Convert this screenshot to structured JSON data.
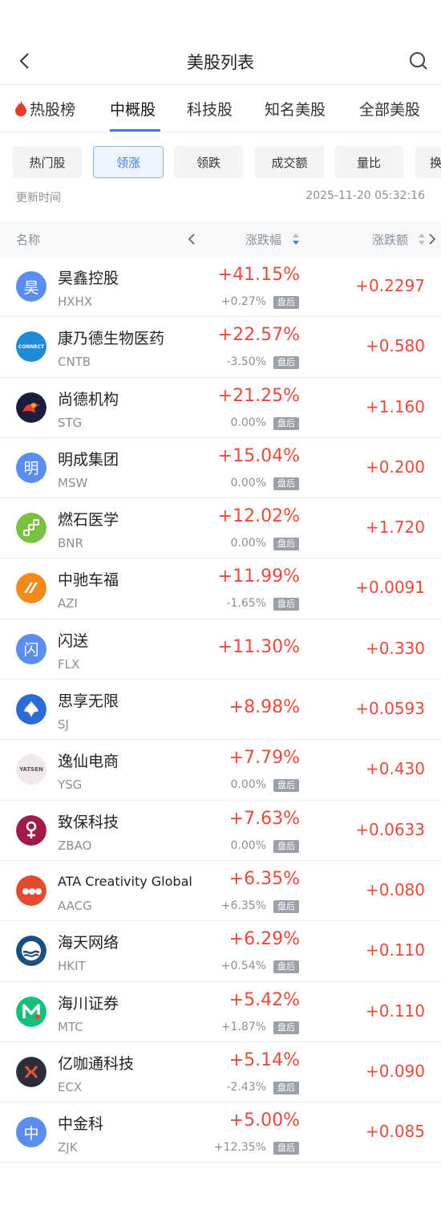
{
  "nav": {
    "title": "美股列表"
  },
  "tabs": [
    "热股榜",
    "中概股",
    "科技股",
    "知名美股",
    "全部美股"
  ],
  "chips": [
    "热门股",
    "领涨",
    "领跌",
    "成交额",
    "量比",
    "换"
  ],
  "update": {
    "label": "更新时间",
    "time": "2025-11-20 05:32:16"
  },
  "header": {
    "name": "名称",
    "pct": "涨跌幅",
    "chg": "涨跌额"
  },
  "badge_text": "盘后",
  "stocks": [
    {
      "name": "昊鑫控股",
      "code": "HXHX",
      "pct": "+41.15%",
      "after": "+0.27%",
      "chg": "+0.2297",
      "logo": "昊",
      "logo_color": "#5b8def"
    },
    {
      "name": "康乃德生物医药",
      "code": "CNTB",
      "pct": "+22.57%",
      "after": "-3.50%",
      "chg": "+0.580",
      "logo": "CONNECT",
      "logo_color": "#1f8ad6"
    },
    {
      "name": "尚德机构",
      "code": "STG",
      "pct": "+21.25%",
      "after": "0.00%",
      "chg": "+1.160",
      "logo": "",
      "logo_color": "#1a1e3a"
    },
    {
      "name": "明成集团",
      "code": "MSW",
      "pct": "+15.04%",
      "after": "0.00%",
      "chg": "+0.200",
      "logo": "明",
      "logo_color": "#5b8def"
    },
    {
      "name": "燃石医学",
      "code": "BNR",
      "pct": "+12.02%",
      "after": "0.00%",
      "chg": "+1.720",
      "logo": "",
      "logo_color": "#7ac143"
    },
    {
      "name": "中驰车福",
      "code": "AZI",
      "pct": "+11.99%",
      "after": "-1.65%",
      "chg": "+0.0091",
      "logo": "",
      "logo_color": "#f28a1b"
    },
    {
      "name": "闪送",
      "code": "FLX",
      "pct": "+11.30%",
      "after": "",
      "chg": "+0.330",
      "logo": "闪",
      "logo_color": "#5b8def"
    },
    {
      "name": "思享无限",
      "code": "SJ",
      "pct": "+8.98%",
      "after": "",
      "chg": "+0.0593",
      "logo": "",
      "logo_color": "#2b6bd6"
    },
    {
      "name": "逸仙电商",
      "code": "YSG",
      "pct": "+7.79%",
      "after": "0.00%",
      "chg": "+0.430",
      "logo": "YATSEN",
      "logo_color": "#f1e9ea"
    },
    {
      "name": "致保科技",
      "code": "ZBAO",
      "pct": "+7.63%",
      "after": "0.00%",
      "chg": "+0.0633",
      "logo": "",
      "logo_color": "#a01b4a"
    },
    {
      "name": "ATA Creativity Global",
      "code": "AACG",
      "pct": "+6.35%",
      "after": "+6.35%",
      "chg": "+0.080",
      "logo": "",
      "logo_color": "#e44a2c"
    },
    {
      "name": "海天网络",
      "code": "HKIT",
      "pct": "+6.29%",
      "after": "+0.54%",
      "chg": "+0.110",
      "logo": "",
      "logo_color": "#1d4f7c"
    },
    {
      "name": "海川证券",
      "code": "MTC",
      "pct": "+5.42%",
      "after": "+1.87%",
      "chg": "+0.110",
      "logo": "",
      "logo_color": "#17c07a"
    },
    {
      "name": "亿咖通科技",
      "code": "ECX",
      "pct": "+5.14%",
      "after": "-2.43%",
      "chg": "+0.090",
      "logo": "",
      "logo_color": "#2a2f3a"
    },
    {
      "name": "中金科",
      "code": "ZJK",
      "pct": "+5.00%",
      "after": "+12.35%",
      "chg": "+0.085",
      "logo": "中",
      "logo_color": "#5b8def"
    }
  ]
}
